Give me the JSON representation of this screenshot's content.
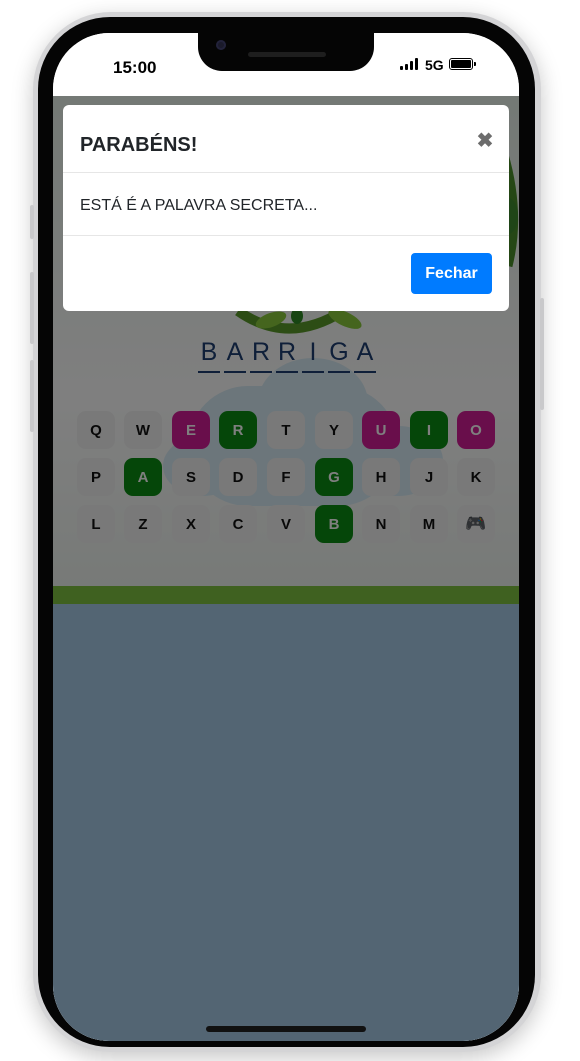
{
  "status_bar": {
    "time": "15:00",
    "network": "5G"
  },
  "modal": {
    "title": "PARABÉNS!",
    "close_glyph": "✖",
    "message": "ESTÁ É A PALAVRA SECRETA...",
    "close_button_label": "Fechar"
  },
  "secret_word": {
    "letters": [
      "B",
      "A",
      "R",
      "R",
      "I",
      "G",
      "A"
    ]
  },
  "keyboard": {
    "rows": [
      [
        {
          "label": "Q",
          "state": "default"
        },
        {
          "label": "W",
          "state": "default"
        },
        {
          "label": "E",
          "state": "wrong"
        },
        {
          "label": "R",
          "state": "correct"
        },
        {
          "label": "T",
          "state": "default"
        },
        {
          "label": "Y",
          "state": "default"
        },
        {
          "label": "U",
          "state": "wrong"
        },
        {
          "label": "I",
          "state": "correct"
        },
        {
          "label": "O",
          "state": "wrong"
        }
      ],
      [
        {
          "label": "P",
          "state": "default"
        },
        {
          "label": "A",
          "state": "correct"
        },
        {
          "label": "S",
          "state": "default"
        },
        {
          "label": "D",
          "state": "default"
        },
        {
          "label": "F",
          "state": "default"
        },
        {
          "label": "G",
          "state": "correct"
        },
        {
          "label": "H",
          "state": "default"
        },
        {
          "label": "J",
          "state": "default"
        },
        {
          "label": "K",
          "state": "default"
        }
      ],
      [
        {
          "label": "L",
          "state": "default"
        },
        {
          "label": "Z",
          "state": "default"
        },
        {
          "label": "X",
          "state": "default"
        },
        {
          "label": "C",
          "state": "default"
        },
        {
          "label": "V",
          "state": "default"
        },
        {
          "label": "B",
          "state": "correct"
        },
        {
          "label": "N",
          "state": "default"
        },
        {
          "label": "M",
          "state": "default"
        },
        {
          "label": "🎮",
          "state": "icon",
          "icon": "gamepad-icon"
        }
      ]
    ]
  },
  "colors": {
    "correct_key": "#0a8c12",
    "wrong_key": "#d21c96",
    "button_primary": "#007bff",
    "word_color": "#1f3f72"
  }
}
